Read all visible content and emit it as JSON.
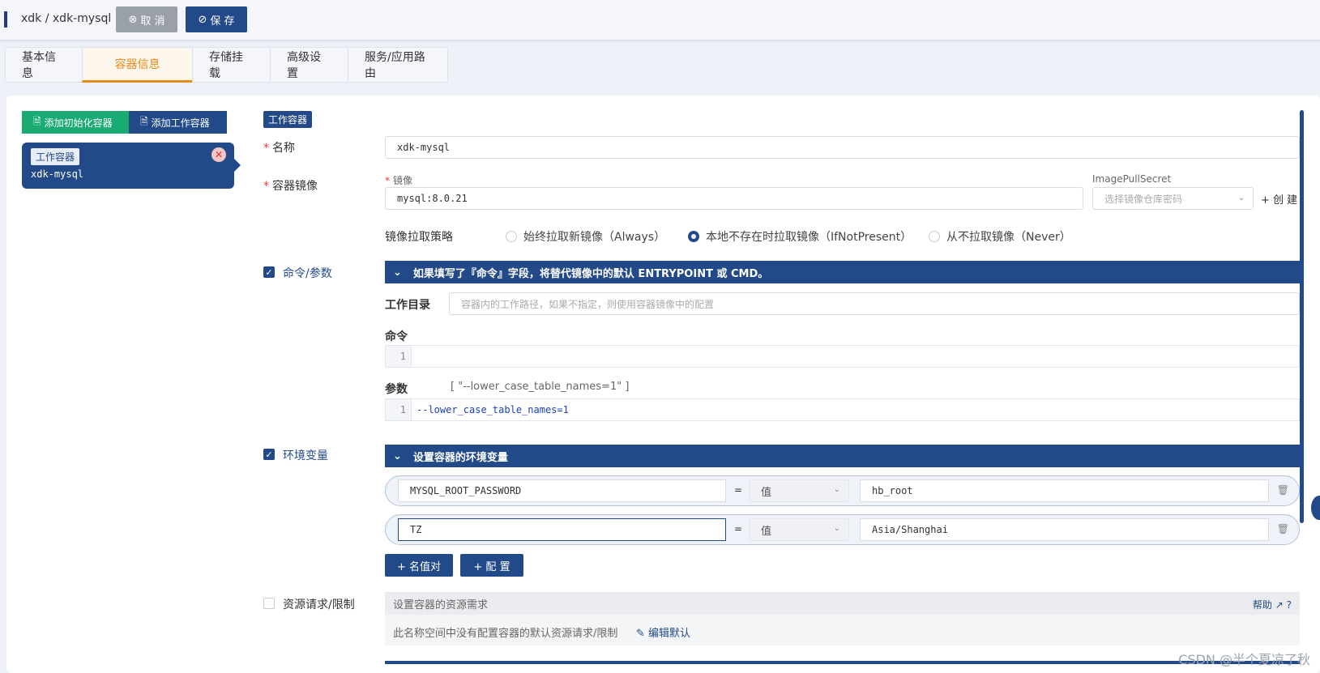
{
  "header": {
    "title": "xdk / xdk-mysql",
    "cancel_label": "取 消",
    "save_label": "保 存"
  },
  "tabs": [
    {
      "label": "基本信息"
    },
    {
      "label": "容器信息",
      "active": true
    },
    {
      "label": "存储挂载"
    },
    {
      "label": "高级设置"
    },
    {
      "label": "服务/应用路由"
    }
  ],
  "left": {
    "add_init_label": "添加初始化容器",
    "add_work_label": "添加工作容器",
    "card_tag": "工作容器",
    "card_name": "xdk-mysql"
  },
  "form": {
    "section_tag": "工作容器",
    "name_label": "名称",
    "name_value": "xdk-mysql",
    "image_label": "容器镜像",
    "image_sub_label": "镜像",
    "image_value": "mysql:8.0.21",
    "pull_secret_label": "ImagePullSecret",
    "pull_secret_placeholder": "选择镜像仓库密码",
    "create_label": "+ 创 建",
    "pull_policy_label": "镜像拉取策略",
    "pull_policies": [
      {
        "label": "始终拉取新镜像（Always）",
        "selected": false
      },
      {
        "label": "本地不存在时拉取镜像（IfNotPresent）",
        "selected": true
      },
      {
        "label": "从不拉取镜像（Never）",
        "selected": false
      }
    ],
    "cmd_label": "命令/参数",
    "cmd_banner": "如果填写了『命令』字段，将替代镜像中的默认 ENTRYPOINT 或 CMD。",
    "workdir_label": "工作目录",
    "workdir_placeholder": "容器内的工作路径，如果不指定，则使用容器镜像中的配置",
    "command_label": "命令",
    "command_line_no": "1",
    "command_value": "",
    "args_label": "参数",
    "args_hint": "[ \"--lower_case_table_names=1\" ]",
    "args_line_no": "1",
    "args_value": "--lower_case_table_names=1",
    "env_label": "环境变量",
    "env_banner": "设置容器的环境变量",
    "env_rows": [
      {
        "name": "MYSQL_ROOT_PASSWORD",
        "eq": "=",
        "type": "值",
        "value": "hb_root"
      },
      {
        "name": "TZ",
        "eq": "=",
        "type": "值",
        "value": "Asia/Shanghai"
      }
    ],
    "add_pair_label": "+ 名值对",
    "add_config_label": "+ 配 置",
    "resource_label": "资源请求/限制",
    "resource_head": "设置容器的资源需求",
    "help_label": "帮助",
    "resource_body": "此名称空间中没有配置容器的默认资源请求/限制",
    "edit_default_label": "编辑默认"
  },
  "watermark": "CSDN @半个夏凉了秋"
}
